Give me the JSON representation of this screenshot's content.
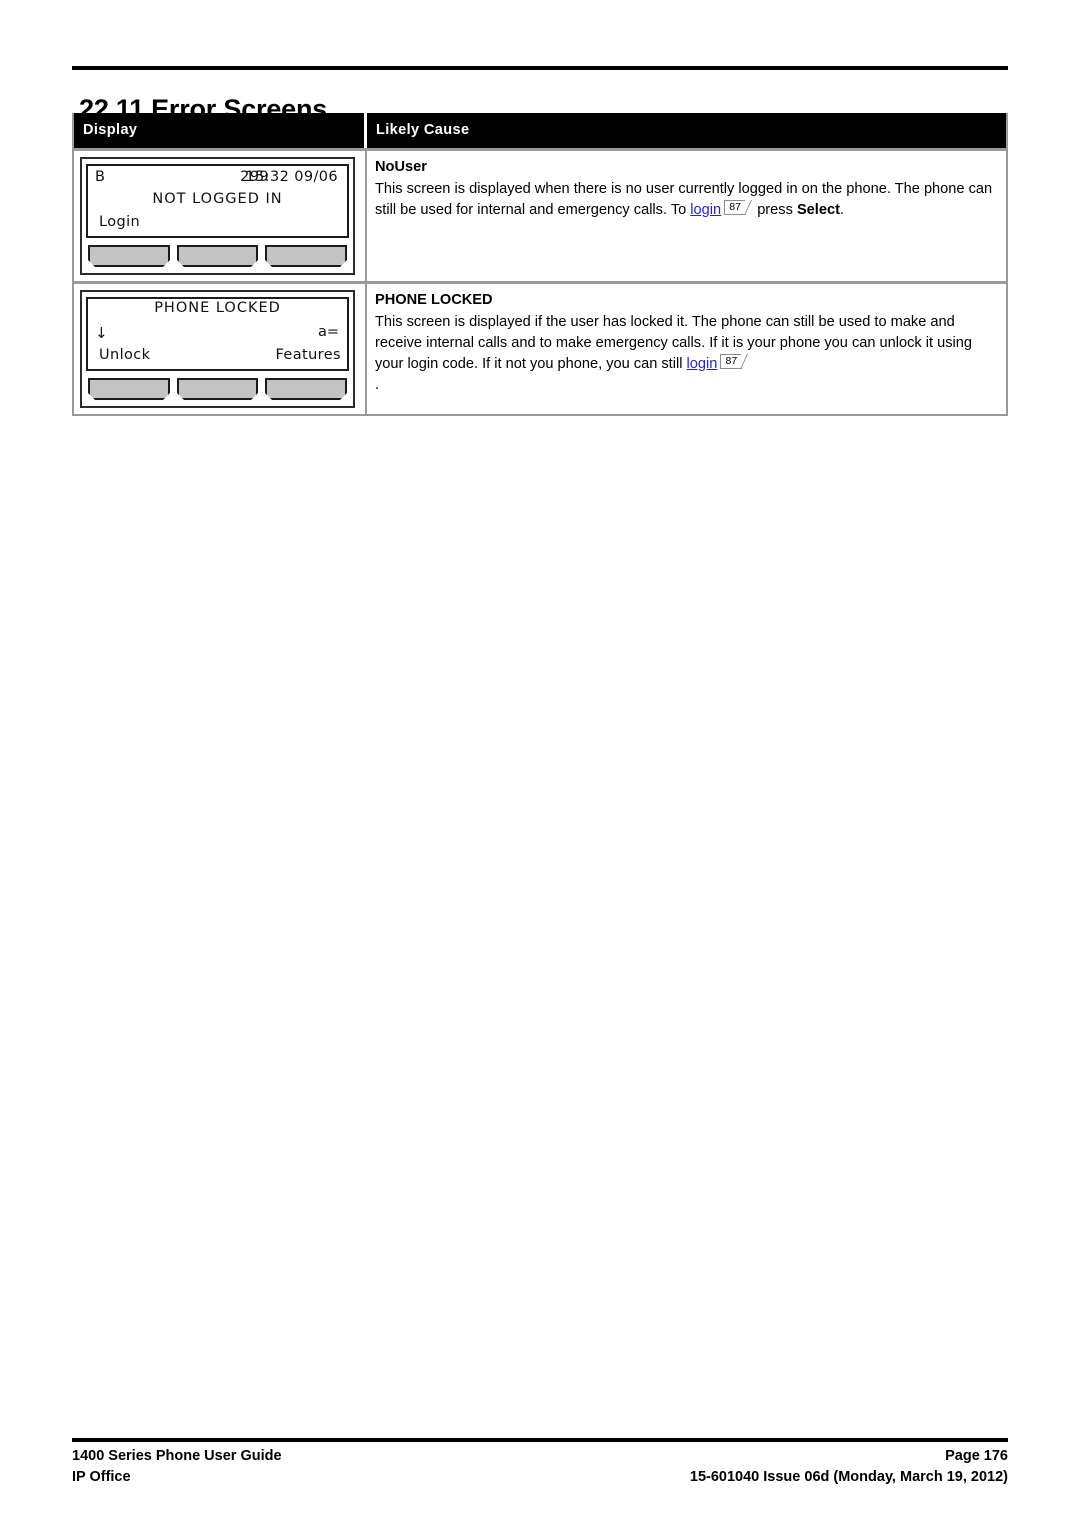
{
  "document": {
    "heading_number": "22.11",
    "heading_text": "Error Screens"
  },
  "table": {
    "columns": [
      "Display",
      "Likely Cause"
    ],
    "rows": [
      {
        "display": {
          "type": "phone-screen",
          "line1_left": "B",
          "line1_mid": "299",
          "line1_right": "15:32 09/06",
          "line2_center": "NOT LOGGED IN",
          "line3_left": "Login",
          "softkeys": [
            "",
            "",
            ""
          ]
        },
        "cause": {
          "title": "NoUser",
          "text_part1": "This screen is displayed when there is no user currently logged in on the phone. The phone can still be used for internal and emergency calls. To ",
          "link_text": "login",
          "page_ref": "87",
          "text_part2": " press ",
          "bold_tail": "Select",
          "text_part3": "."
        }
      },
      {
        "display": {
          "type": "phone-screen",
          "line1_center": "PHONE LOCKED",
          "line2_left": "↓",
          "line2_right": "a=",
          "line3_left": "Unlock",
          "line3_right": "Features",
          "softkeys": [
            "",
            "",
            ""
          ]
        },
        "cause": {
          "title": "PHONE LOCKED",
          "text_part1": "This screen is displayed if the user has locked it. The phone can still be used to make and receive internal calls and to make emergency calls. If it is your phone you can unlock it using your login code. If it not you phone, you can still ",
          "link_text": "login",
          "page_ref": "87",
          "text_part2": "",
          "text_part3": "."
        }
      }
    ]
  },
  "footer": {
    "left_line1": "1400 Series Phone User Guide",
    "left_line2": "IP Office",
    "right_line1": "Page 176",
    "right_line2": "15-601040 Issue 06d (Monday, March 19, 2012)"
  },
  "colors": {
    "link": "#2323dd",
    "header_bg": "#000000",
    "header_fg": "#ffffff",
    "table_border": "#9a9a9a",
    "softkey_fill": "#c3c3c3"
  }
}
